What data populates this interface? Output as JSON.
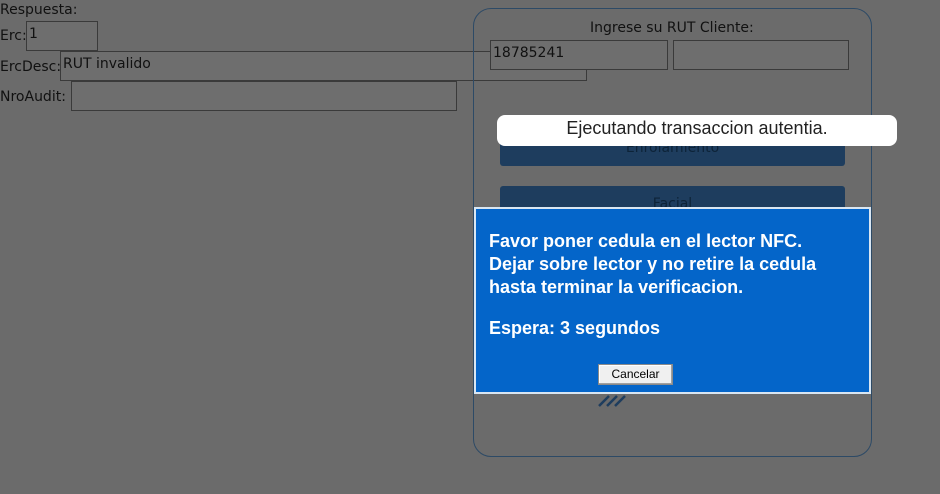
{
  "form": {
    "respuesta_label": "Respuesta:",
    "erc_label": "Erc:",
    "erc_value": "1",
    "ercdesc_label": "ErcDesc:",
    "ercdesc_value": "RUT invalido",
    "nroaudit_label": "NroAudit:",
    "nroaudit_value": ""
  },
  "panel": {
    "title": "Ingrese su RUT Cliente:",
    "rut_value": "18785241",
    "dv_value": "",
    "enrolamiento_label": "Enrolamiento",
    "facial_label": "Facial"
  },
  "toast": {
    "text": "Ejecutando transaccion autentia."
  },
  "dialog": {
    "lines": [
      "Favor poner cedula en el lector NFC.",
      "Dejar sobre lector y no retire la cedula",
      "hasta terminar la verificacion."
    ],
    "wait_text": "Espera: 3 segundos",
    "cancel_label": "Cancelar"
  },
  "colors": {
    "dialog_bg": "#0465c9",
    "overlay_bg": "#6b6b6b",
    "button_dark": "#1e3d5e"
  }
}
